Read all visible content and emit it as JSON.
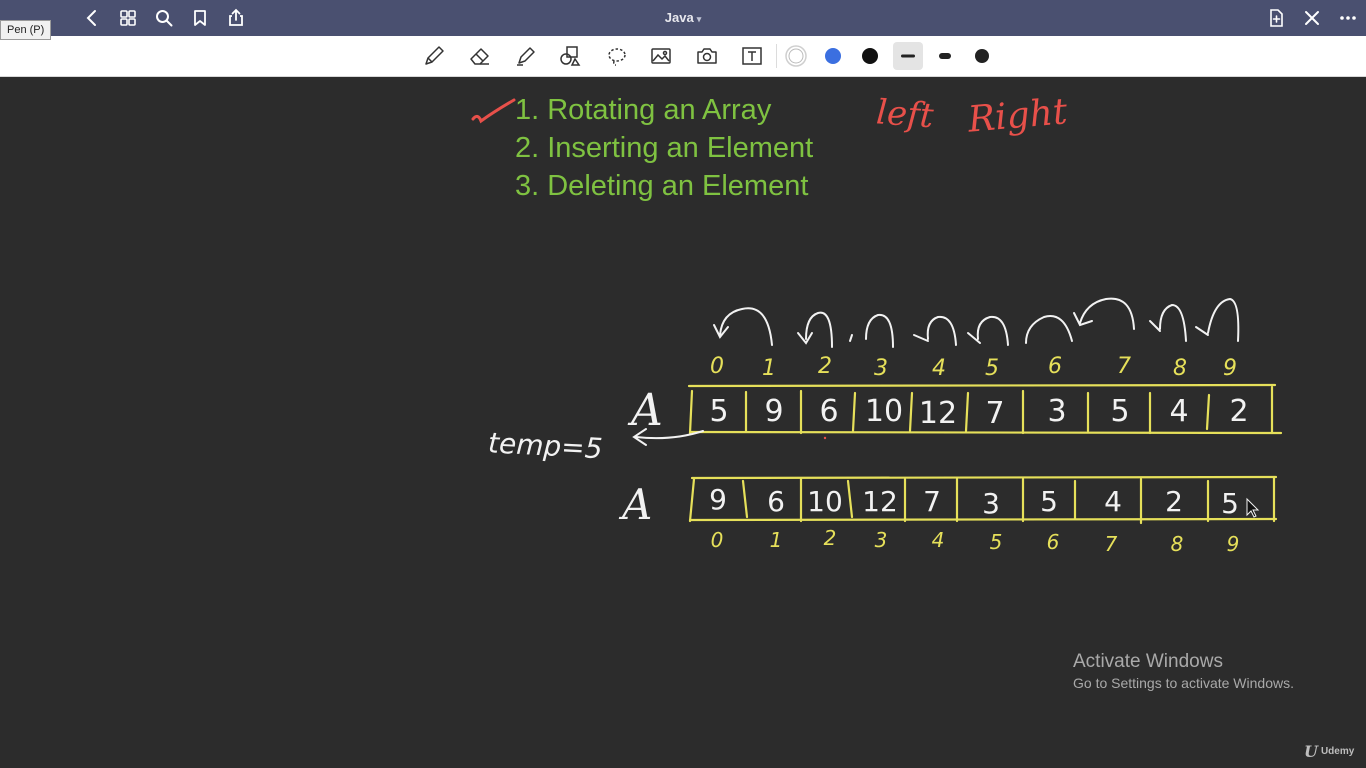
{
  "app": {
    "document_title": "Java",
    "tooltip": "Pen (P)"
  },
  "titlebar": {
    "left_icons": [
      "back-icon",
      "grid-icon",
      "search-icon",
      "bookmark-icon",
      "share-icon"
    ],
    "right_icons": [
      "new-page-icon",
      "close-icon",
      "more-icon"
    ]
  },
  "toolbar": {
    "tools": [
      "pen-tool",
      "eraser-tool",
      "highlighter-tool",
      "shapes-tool",
      "lasso-tool",
      "image-tool",
      "camera-tool",
      "text-tool"
    ],
    "colors": {
      "white": "#ffffff",
      "blue": "#3b6fe0",
      "black": "#111111"
    },
    "selected_stroke": "thin"
  },
  "notes": {
    "topics": [
      "1. Rotating an Array",
      "2. Inserting an Element",
      "3. Deleting an Element"
    ],
    "annotation_left": "left",
    "annotation_right": "Right",
    "array_label": "A",
    "temp_label": "temp=5",
    "indices": [
      "0",
      "1",
      "2",
      "3",
      "4",
      "5",
      "6",
      "7",
      "8",
      "9"
    ],
    "array_before": [
      "5",
      "9",
      "6",
      "10",
      "12",
      "7",
      "3",
      "5",
      "4",
      "2"
    ],
    "array_after": [
      "9",
      "6",
      "10",
      "12",
      "7",
      "3",
      "5",
      "4",
      "2",
      "5"
    ],
    "colors": {
      "green": "#7fc241",
      "red": "#e8504a",
      "yellow": "#e6e05a",
      "white": "#f2f2f2"
    }
  },
  "watermark": {
    "title": "Activate Windows",
    "subtitle": "Go to Settings to activate Windows."
  },
  "branding": {
    "name": "Udemy"
  }
}
